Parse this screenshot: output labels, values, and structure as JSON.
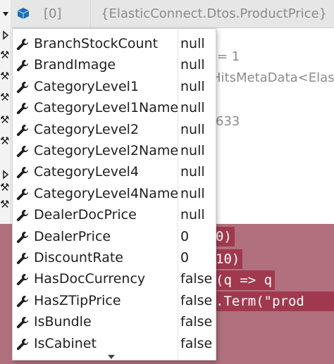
{
  "datatip_header": {
    "index": "[0]",
    "value": "{ElasticConnect.Dtos.ProductPrice}"
  },
  "background_text": [
    {
      "text": "= 1"
    },
    {
      "text": "HitsMetaData<Elas"
    },
    {
      "text": "633"
    }
  ],
  "code_lines": [
    {
      "text": "0)"
    },
    {
      "text": "10)"
    },
    {
      "text": "(q => q"
    },
    {
      "text": "  .Term(\"prod"
    }
  ],
  "members": [
    {
      "name": "BranchStockCount",
      "value": "null",
      "icon": "wrench-icon"
    },
    {
      "name": "BrandImage",
      "value": "null",
      "icon": "wrench-icon"
    },
    {
      "name": "CategoryLevel1",
      "value": "null",
      "icon": "wrench-icon"
    },
    {
      "name": "CategoryLevel1Name",
      "value": "null",
      "icon": "wrench-icon"
    },
    {
      "name": "CategoryLevel2",
      "value": "null",
      "icon": "wrench-icon"
    },
    {
      "name": "CategoryLevel2Name",
      "value": "null",
      "icon": "wrench-icon"
    },
    {
      "name": "CategoryLevel4",
      "value": "null",
      "icon": "wrench-icon"
    },
    {
      "name": "CategoryLevel4Name",
      "value": "null",
      "icon": "wrench-icon"
    },
    {
      "name": "DealerDocPrice",
      "value": "null",
      "icon": "wrench-icon"
    },
    {
      "name": "DealerPrice",
      "value": "0",
      "icon": "wrench-icon"
    },
    {
      "name": "DiscountRate",
      "value": "0",
      "icon": "wrench-icon"
    },
    {
      "name": "HasDocCurrency",
      "value": "false",
      "icon": "wrench-icon"
    },
    {
      "name": "HasZTipPrice",
      "value": "false",
      "icon": "wrench-icon"
    },
    {
      "name": "IsBundle",
      "value": "false",
      "icon": "wrench-icon"
    },
    {
      "name": "IsCabinet",
      "value": "false",
      "icon": "wrench-icon"
    }
  ],
  "colors": {
    "highlight": "#b1707e",
    "code_highlight": "#a1394e",
    "header_bg": "#e6e6e6",
    "object_icon": "#1f6fb5"
  }
}
